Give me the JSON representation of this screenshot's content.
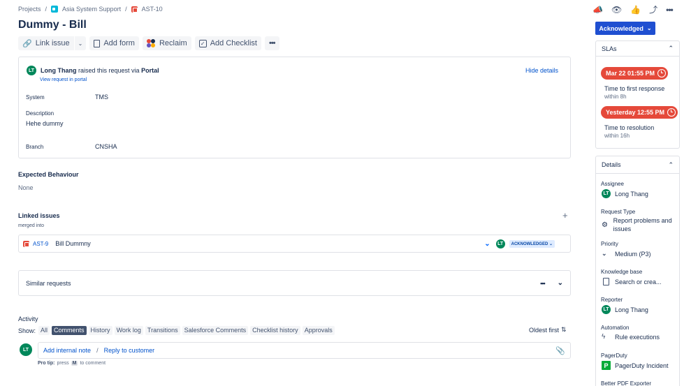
{
  "breadcrumb": {
    "projects": "Projects",
    "sep": "/",
    "project": "Asia System Support",
    "issue_key": "AST-10"
  },
  "title": "Dummy - Bill",
  "toolbar": {
    "link_issue": "Link issue",
    "add_form": "Add form",
    "reclaim": "Reclaim",
    "add_checklist": "Add Checklist",
    "more": "•••"
  },
  "request": {
    "avatar": "LT",
    "reporter": "Long Thang",
    "raised_text": "raised this request via",
    "channel": "Portal",
    "view_portal": "View request in portal",
    "hide_details": "Hide details",
    "fields": [
      {
        "label": "System",
        "value": "TMS"
      },
      {
        "label": "Description",
        "value": "Hehe dummy"
      },
      {
        "label": "Branch",
        "value": "CNSHA"
      }
    ]
  },
  "expected": {
    "title": "Expected Behaviour",
    "value": "None"
  },
  "linked": {
    "title": "Linked issues",
    "add": "+",
    "relation": "merged into",
    "issue_key": "AST-9",
    "issue_summary": "Bill Dummny",
    "avatar": "LT",
    "status": "ACKNOWLEDGED"
  },
  "similar": {
    "title": "Similar requests",
    "more": "•••"
  },
  "activity": {
    "title": "Activity",
    "show_label": "Show:",
    "tabs": [
      "All",
      "Comments",
      "History",
      "Work log",
      "Transitions",
      "Salesforce Comments",
      "Checklist history",
      "Approvals"
    ],
    "active_tab": "Comments",
    "sort": "Oldest first",
    "avatar": "LT",
    "add_internal": "Add internal note",
    "sep": "/",
    "reply": "Reply to customer",
    "pro_tip_label": "Pro tip:",
    "pro_tip_press": "press",
    "pro_tip_key": "M",
    "pro_tip_rest": "to comment"
  },
  "status_button": "Acknowledged",
  "slas": {
    "title": "SLAs",
    "items": [
      {
        "time": "Mar 22 01:55 PM",
        "name": "Time to first response",
        "goal": "within 8h"
      },
      {
        "time": "Yesterday 12:55 PM",
        "name": "Time to resolution",
        "goal": "within 16h"
      }
    ]
  },
  "details": {
    "title": "Details",
    "assignee_label": "Assignee",
    "assignee_avatar": "LT",
    "assignee": "Long Thang",
    "request_type_label": "Request Type",
    "request_type": "Report problems and issues",
    "priority_label": "Priority",
    "priority": "Medium (P3)",
    "kb_label": "Knowledge base",
    "kb": "Search or crea...",
    "reporter_label": "Reporter",
    "reporter_avatar": "LT",
    "reporter": "Long Thang",
    "automation_label": "Automation",
    "automation": "Rule executions",
    "pagerduty_label": "PagerDuty",
    "pagerduty": "PagerDuty Incident",
    "pdf_label": "Better PDF Exporter"
  },
  "colors": {
    "primary": "#0052cc",
    "sla_red": "#e5493a",
    "avatar_green": "#00875a",
    "status_blue": "#1f4fd1",
    "pagerduty_green": "#06ac38"
  }
}
